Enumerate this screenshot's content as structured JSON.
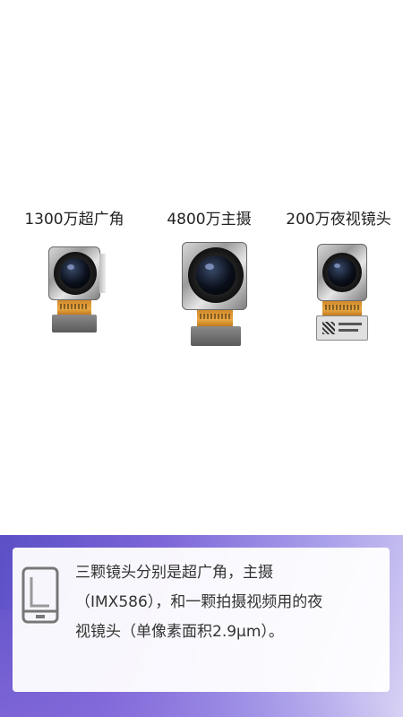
{
  "labels": {
    "ultra_wide": "1300万超广角",
    "main": "4800万主摄",
    "night": "200万夜视镜头"
  },
  "caption": {
    "line1": "三颗镜头分别是超广角，主摄",
    "line2": "（IMX586），和一颗拍摄视频用的夜",
    "line3": "视镜头（单像素面积2.9μm）。"
  },
  "icons": {
    "caption_icon": "phone-outline-icon"
  },
  "colors": {
    "panel_gradient_start": "#5b4fc6",
    "panel_gradient_end": "#d8d2f4",
    "card_bg": "#ffffff"
  }
}
